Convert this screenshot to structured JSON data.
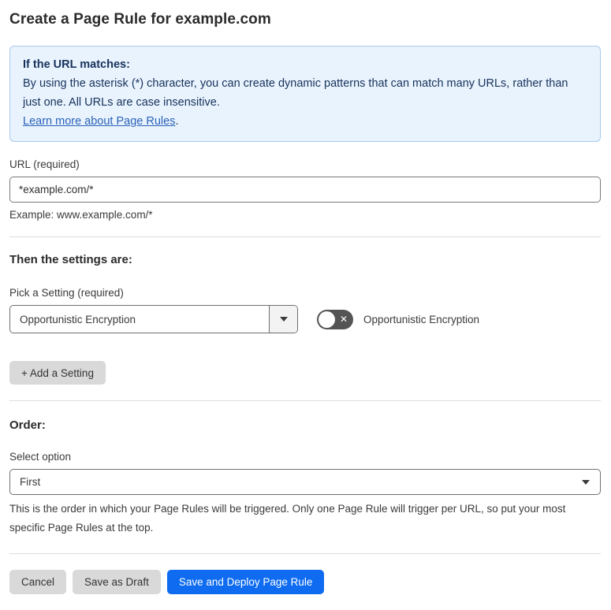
{
  "page": {
    "title": "Create a Page Rule for example.com"
  },
  "info_box": {
    "heading": "If the URL matches:",
    "body": "By using the asterisk (*) character, you can create dynamic patterns that can match many URLs, rather than just one. All URLs are case insensitive.",
    "link_label": "Learn more about Page Rules",
    "link_suffix": "."
  },
  "url_section": {
    "label": "URL (required)",
    "value": "*example.com/*",
    "example": "Example: www.example.com/*"
  },
  "settings_section": {
    "heading": "Then the settings are:",
    "pick_label": "Pick a Setting (required)",
    "selected_setting": "Opportunistic Encryption",
    "toggle_label": "Opportunistic Encryption",
    "toggle_state": "off",
    "toggle_glyph": "✕",
    "add_setting_label": "+ Add a Setting"
  },
  "order_section": {
    "heading": "Order:",
    "select_label": "Select option",
    "selected_option": "First",
    "help_text": "This is the order in which your Page Rules will be triggered. Only one Page Rule will trigger per URL, so put your most specific Page Rules at the top."
  },
  "footer": {
    "cancel_label": "Cancel",
    "save_draft_label": "Save as Draft",
    "save_deploy_label": "Save and Deploy Page Rule"
  },
  "colors": {
    "accent_blue": "#0f6cf0",
    "info_background": "#e9f3fd",
    "info_border": "#a9c9ee",
    "info_text": "#16325c",
    "link_blue": "#2a62b9",
    "toggle_off": "#545454",
    "button_gray": "#d9d9d9"
  }
}
